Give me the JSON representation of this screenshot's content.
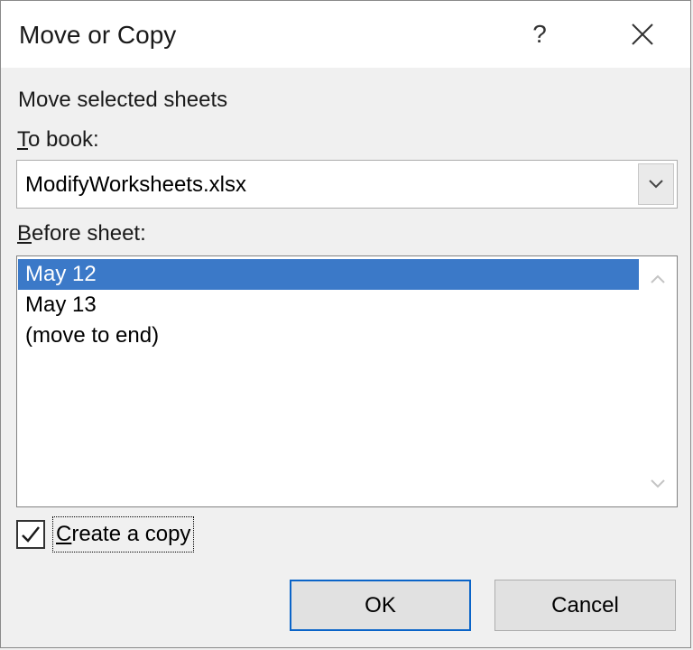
{
  "dialog": {
    "title": "Move or Copy",
    "help_label": "?",
    "instruction": "Move selected sheets",
    "to_book_label_accel": "T",
    "to_book_label_rest": "o book:",
    "to_book_value": "ModifyWorksheets.xlsx",
    "before_sheet_label_accel": "B",
    "before_sheet_label_rest": "efore sheet:",
    "before_sheet_items": [
      "May 12",
      "May 13",
      "(move to end)"
    ],
    "selected_index": 0,
    "create_copy_accel": "C",
    "create_copy_rest": "reate a copy",
    "create_copy_checked": true,
    "ok_label": "OK",
    "cancel_label": "Cancel"
  },
  "icons": {
    "close": "close-icon",
    "dropdown": "chevron-down-icon",
    "scroll_up": "chevron-up-icon",
    "scroll_down": "chevron-down-icon",
    "check": "checkmark-icon"
  },
  "colors": {
    "selection": "#3b79c8",
    "default_button_border": "#0a64c8"
  }
}
